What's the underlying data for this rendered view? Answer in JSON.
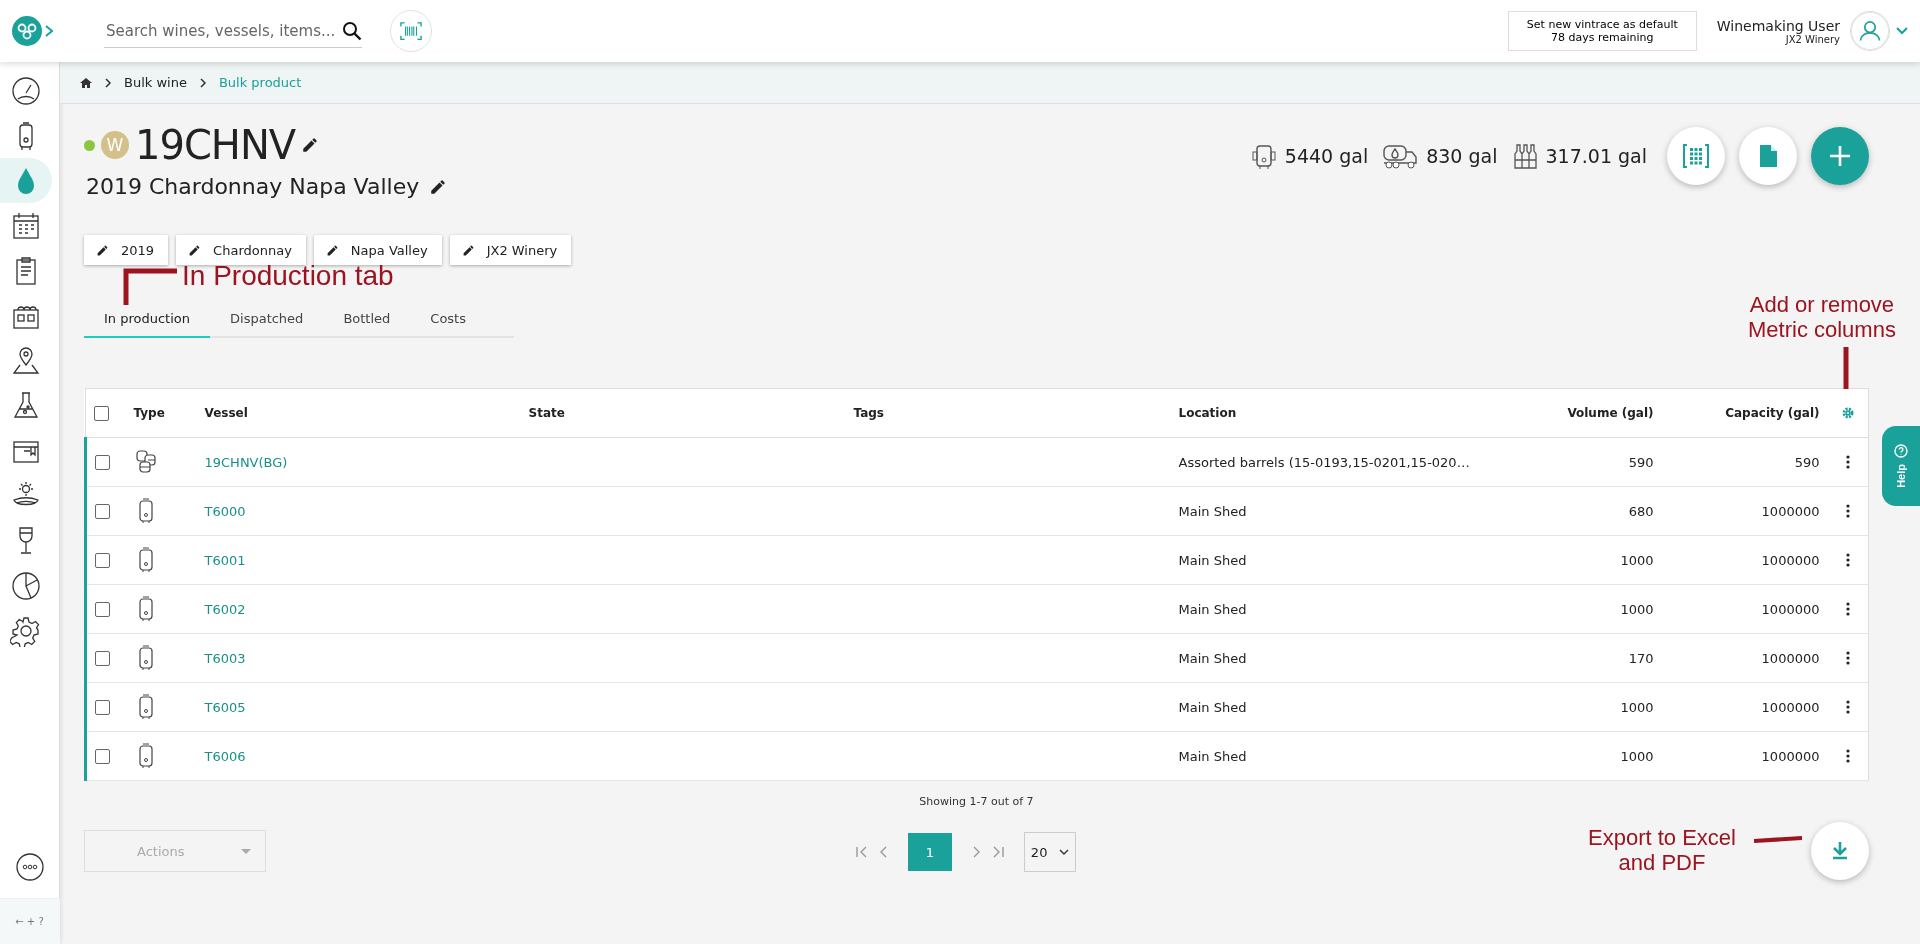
{
  "topbar": {
    "search": {
      "placeholder": "Search wines, vessels, items..."
    },
    "notice": [
      "Set new vintrace as default",
      "78 days remaining"
    ],
    "user": {
      "name": "Winemaking User",
      "winery": "JX2 Winery"
    }
  },
  "sidebar": {
    "items": [
      {
        "selected": false
      },
      {
        "selected": false
      },
      {
        "selected": true
      },
      {
        "selected": false
      },
      {
        "selected": false
      },
      {
        "selected": false
      },
      {
        "selected": false
      },
      {
        "selected": false
      },
      {
        "selected": false
      },
      {
        "selected": false
      },
      {
        "selected": false
      },
      {
        "selected": false
      },
      {
        "selected": false
      }
    ],
    "footer": "← + ?"
  },
  "breadcrumb": [
    "Bulk wine",
    "Bulk product"
  ],
  "product": {
    "code": "19CHNV",
    "badge": "W",
    "status": {
      "color": "#8cc63f"
    },
    "name": "2019 Chardonnay Napa Valley",
    "chips": [
      "2019",
      "Chardonnay",
      "Napa Valley",
      "JX2 Winery"
    ]
  },
  "stats": [
    "5440 gal",
    "830 gal",
    "317.01 gal"
  ],
  "tabs": [
    {
      "label": "In production",
      "selected": true
    },
    {
      "label": "Dispatched",
      "selected": false
    },
    {
      "label": "Bottled",
      "selected": false
    },
    {
      "label": "Costs",
      "selected": false
    }
  ],
  "table": {
    "select_all": {
      "checked": false
    },
    "columns": [
      "Type",
      "Vessel",
      "State",
      "Tags",
      "Location",
      "Volume (gal)",
      "Capacity (gal)"
    ],
    "rows": [
      {
        "kind": "barrels",
        "checked": false,
        "vessel": "19CHNV(BG)",
        "location": "Assorted barrels (15-0193,15-0201,15-020…",
        "volume": "590",
        "capacity": "590"
      },
      {
        "kind": "tank",
        "checked": false,
        "vessel": "T6000",
        "location": "Main Shed",
        "volume": "680",
        "capacity": "1000000"
      },
      {
        "kind": "tank",
        "checked": false,
        "vessel": "T6001",
        "location": "Main Shed",
        "volume": "1000",
        "capacity": "1000000"
      },
      {
        "kind": "tank",
        "checked": false,
        "vessel": "T6002",
        "location": "Main Shed",
        "volume": "1000",
        "capacity": "1000000"
      },
      {
        "kind": "tank",
        "checked": false,
        "vessel": "T6003",
        "location": "Main Shed",
        "volume": "170",
        "capacity": "1000000"
      },
      {
        "kind": "tank",
        "checked": false,
        "vessel": "T6005",
        "location": "Main Shed",
        "volume": "1000",
        "capacity": "1000000"
      },
      {
        "kind": "tank",
        "checked": false,
        "vessel": "T6006",
        "location": "Main Shed",
        "volume": "1000",
        "capacity": "1000000"
      }
    ]
  },
  "showing": "Showing 1-7 out of 7",
  "actions": "Actions",
  "pagination": {
    "page": "1",
    "page_size": "20"
  },
  "help": "Help",
  "annotations": {
    "tab": "In Production tab",
    "columns": [
      "Add or remove",
      "Metric columns"
    ],
    "export": [
      "Export to Excel",
      "and PDF"
    ]
  }
}
